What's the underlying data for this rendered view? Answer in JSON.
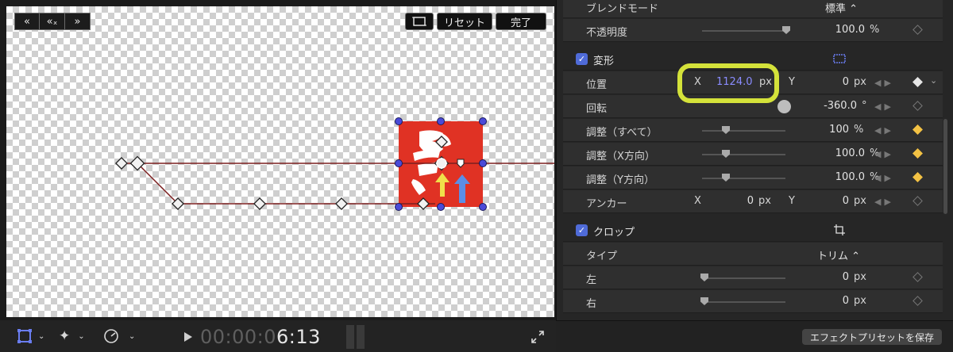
{
  "viewer": {
    "keyframe_buttons": [
      "«",
      "«ₓ",
      "»"
    ],
    "toggle_label": "",
    "reset_label": "リセット",
    "done_label": "完了",
    "timecode_dim": "00:00:0",
    "timecode_bright": "6:13",
    "tools": [
      "transform-icon",
      "magic-wand-icon",
      "speed-icon"
    ]
  },
  "inspector": {
    "blend_mode": {
      "label": "ブレンドモード",
      "value": "標準"
    },
    "opacity": {
      "label": "不透明度",
      "value": "100.0",
      "unit": "%",
      "level": 1.0
    },
    "transform": {
      "title": "変形"
    },
    "position": {
      "label": "位置",
      "x_label": "X",
      "x_value": "1124.0",
      "x_unit": "px",
      "y_label": "Y",
      "y_value": "0",
      "y_unit": "px"
    },
    "rotation": {
      "label": "回転",
      "value": "-360.0",
      "unit": "°"
    },
    "scale_all": {
      "label": "調整（すべて）",
      "value": "100",
      "unit": "%",
      "level": 0.28
    },
    "scale_x": {
      "label": "調整（X方向）",
      "value": "100.0",
      "unit": "%",
      "level": 0.28
    },
    "scale_y": {
      "label": "調整（Y方向）",
      "value": "100.0",
      "unit": "%",
      "level": 0.28
    },
    "anchor": {
      "label": "アンカー",
      "x_label": "X",
      "x_value": "0",
      "x_unit": "px",
      "y_label": "Y",
      "y_value": "0",
      "y_unit": "px"
    },
    "crop": {
      "title": "クロップ"
    },
    "crop_type": {
      "label": "タイプ",
      "value": "トリム"
    },
    "crop_left": {
      "label": "左",
      "value": "0",
      "unit": "px"
    },
    "crop_right": {
      "label": "右",
      "value": "0",
      "unit": "px"
    },
    "save_preset_label": "エフェクトプリセットを保存"
  },
  "colors": {
    "accent": "#5b6ee6",
    "highlight": "#d4e23a",
    "keyframe_on": "#f3c244",
    "clip_red": "#e03224"
  }
}
